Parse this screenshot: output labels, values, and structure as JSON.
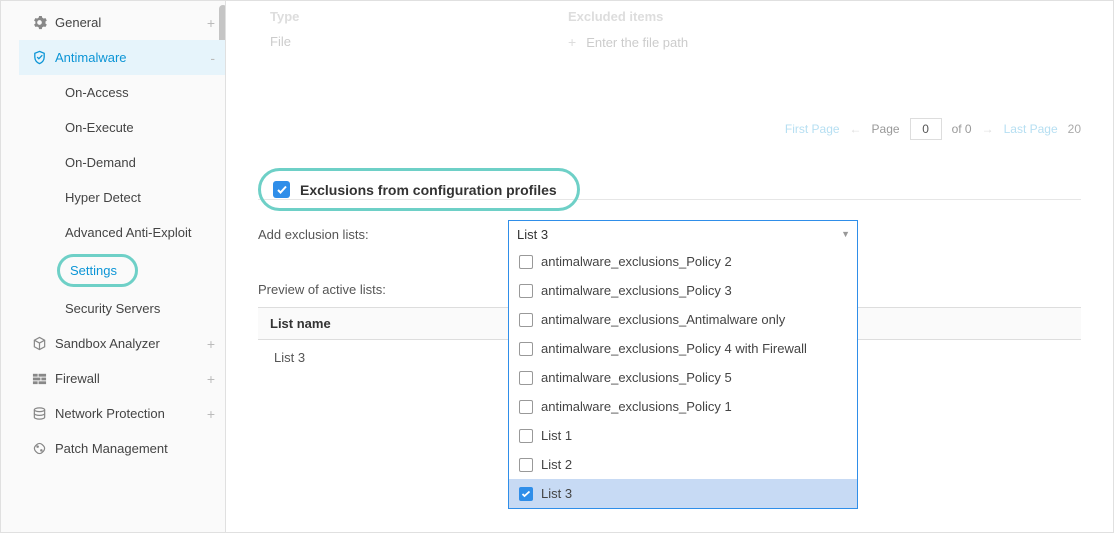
{
  "sidebar": {
    "items": [
      {
        "label": "General",
        "icon": "gear",
        "expand": "+"
      },
      {
        "label": "Antimalware",
        "icon": "shield",
        "expand": "-",
        "active": true
      },
      {
        "label": "Sandbox Analyzer",
        "icon": "cube",
        "expand": "+"
      },
      {
        "label": "Firewall",
        "icon": "blocks",
        "expand": "+"
      },
      {
        "label": "Network Protection",
        "icon": "stack",
        "expand": "+"
      },
      {
        "label": "Patch Management",
        "icon": "patch",
        "expand": ""
      }
    ],
    "antimalware_children": [
      {
        "label": "On-Access"
      },
      {
        "label": "On-Execute"
      },
      {
        "label": "On-Demand"
      },
      {
        "label": "Hyper Detect"
      },
      {
        "label": "Advanced Anti-Exploit"
      },
      {
        "label": "Settings",
        "highlight": true
      },
      {
        "label": "Security Servers"
      }
    ]
  },
  "faded": {
    "type_label": "Type",
    "excluded_label": "Excluded items",
    "file_label": "File",
    "placeholder": "Enter the file path"
  },
  "pagination": {
    "first": "First Page",
    "page_label": "Page",
    "page_value": "0",
    "of_label": "of 0",
    "last": "Last Page",
    "per_page": "20"
  },
  "exclusions": {
    "checkbox_label": "Exclusions from configuration profiles",
    "add_label": "Add exclusion lists:",
    "combo_value": "List 3",
    "options": [
      {
        "label": "antimalware_exclusions_Policy 2",
        "checked": false
      },
      {
        "label": "antimalware_exclusions_Policy 3",
        "checked": false
      },
      {
        "label": "antimalware_exclusions_Antimalware only",
        "checked": false
      },
      {
        "label": "antimalware_exclusions_Policy 4 with Firewall",
        "checked": false
      },
      {
        "label": "antimalware_exclusions_Policy 5",
        "checked": false
      },
      {
        "label": "antimalware_exclusions_Policy 1",
        "checked": false
      },
      {
        "label": "List 1",
        "checked": false
      },
      {
        "label": "List 2",
        "checked": false
      },
      {
        "label": "List 3",
        "checked": true
      }
    ]
  },
  "preview": {
    "label": "Preview of active lists:",
    "header": "List name",
    "rows": [
      {
        "name": "List 3"
      }
    ]
  }
}
